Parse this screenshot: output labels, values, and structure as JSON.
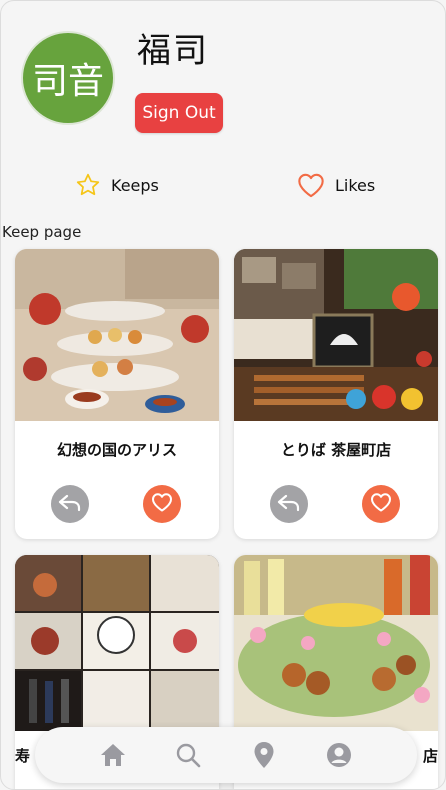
{
  "profile": {
    "avatar_text": "司音",
    "username": "福司",
    "signout_label": "Sign Out"
  },
  "tabs": [
    {
      "label": "Keeps",
      "icon": "star-icon"
    },
    {
      "label": "Likes",
      "icon": "heart-icon"
    }
  ],
  "section_label": "Keep page",
  "cards": [
    {
      "name": "幻想の国のアリス"
    },
    {
      "name": "とりば 茶屋町店"
    },
    {
      "name": "寿"
    },
    {
      "name": "店"
    }
  ],
  "nav": [
    "home-icon",
    "search-icon",
    "location-pin-icon",
    "user-icon"
  ],
  "colors": {
    "avatar": "#67a33d",
    "signout": "#e84141",
    "like": "#f26b45",
    "back": "#a3a3a6",
    "star": "#f5c518"
  }
}
